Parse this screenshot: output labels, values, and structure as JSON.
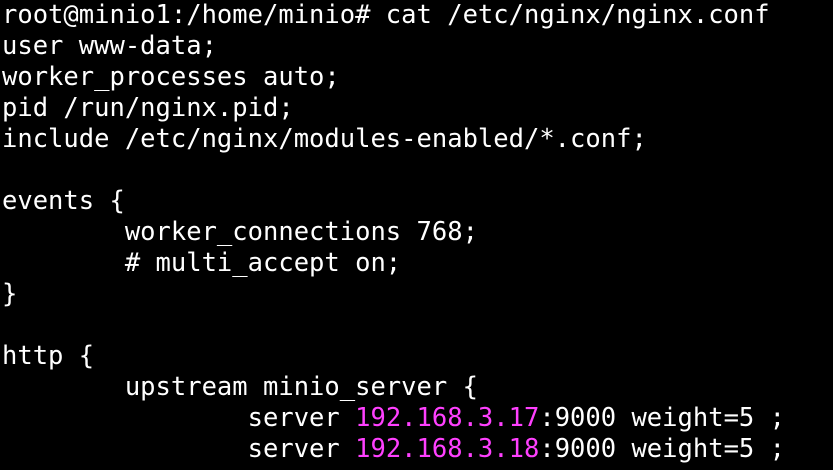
{
  "terminal": {
    "background": "#000000",
    "foreground": "#ffffff",
    "highlight_color": "#ff40ff",
    "lines": [
      {
        "parts": [
          {
            "text": "root@minio1:/home/minio# cat /etc/nginx/nginx.conf"
          }
        ]
      },
      {
        "parts": [
          {
            "text": "user www-data;"
          }
        ]
      },
      {
        "parts": [
          {
            "text": "worker_processes auto;"
          }
        ]
      },
      {
        "parts": [
          {
            "text": "pid /run/nginx.pid;"
          }
        ]
      },
      {
        "parts": [
          {
            "text": "include /etc/nginx/modules-enabled/*.conf;"
          }
        ]
      },
      {
        "parts": [
          {
            "text": ""
          }
        ]
      },
      {
        "parts": [
          {
            "text": "events {"
          }
        ]
      },
      {
        "parts": [
          {
            "text": "        worker_connections 768;"
          }
        ]
      },
      {
        "parts": [
          {
            "text": "        # multi_accept on;"
          }
        ]
      },
      {
        "parts": [
          {
            "text": "}"
          }
        ]
      },
      {
        "parts": [
          {
            "text": ""
          }
        ]
      },
      {
        "parts": [
          {
            "text": "http {"
          }
        ]
      },
      {
        "parts": [
          {
            "text": "        upstream minio_server {"
          }
        ]
      },
      {
        "parts": [
          {
            "text": "                server "
          },
          {
            "text": "192.168.3.17",
            "highlight": true
          },
          {
            "text": ":9000 weight=5 ;"
          }
        ]
      },
      {
        "parts": [
          {
            "text": "                server "
          },
          {
            "text": "192.168.3.18",
            "highlight": true
          },
          {
            "text": ":9000 weight=5 ;"
          }
        ]
      }
    ]
  }
}
